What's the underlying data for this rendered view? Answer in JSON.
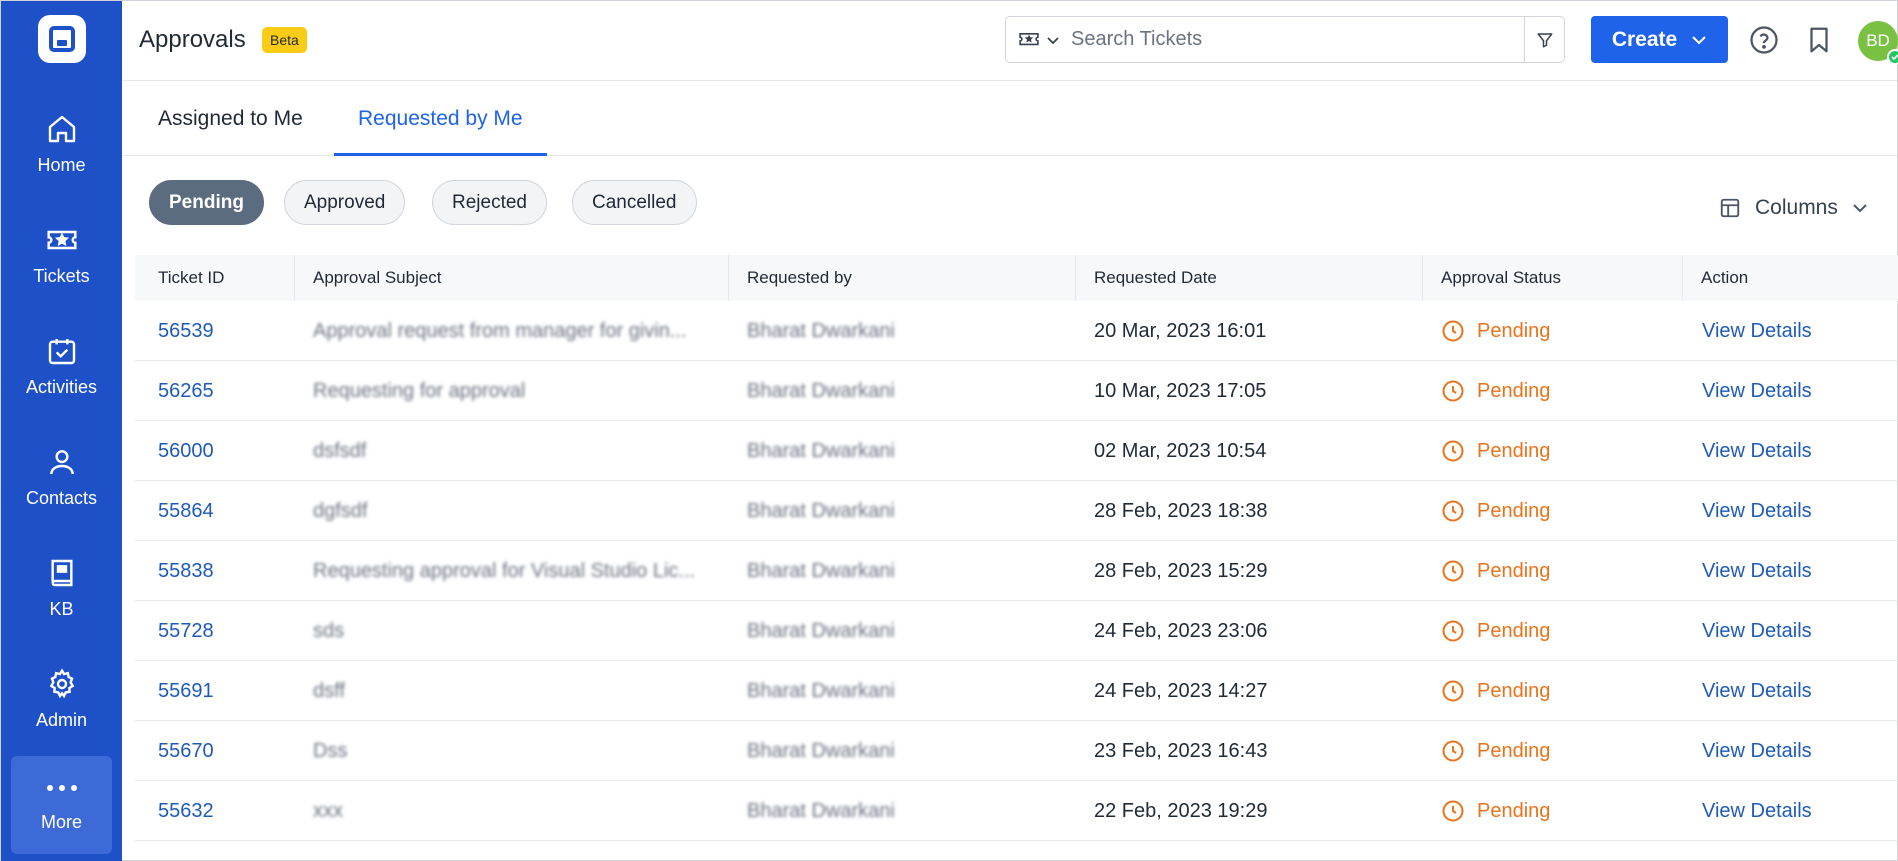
{
  "sidebar": {
    "items": [
      {
        "label": "Home",
        "icon": "home-icon"
      },
      {
        "label": "Tickets",
        "icon": "ticket-icon"
      },
      {
        "label": "Activities",
        "icon": "calendar-check-icon"
      },
      {
        "label": "Contacts",
        "icon": "person-icon"
      },
      {
        "label": "KB",
        "icon": "book-icon"
      },
      {
        "label": "Admin",
        "icon": "gear-icon"
      }
    ],
    "more_label": "More"
  },
  "header": {
    "title": "Approvals",
    "badge": "Beta",
    "search_placeholder": "Search Tickets",
    "create_label": "Create",
    "avatar_initials": "BD"
  },
  "tabs": [
    {
      "label": "Assigned to Me",
      "active": false
    },
    {
      "label": "Requested by Me",
      "active": true
    }
  ],
  "filters": [
    {
      "label": "Pending",
      "active": true
    },
    {
      "label": "Approved",
      "active": false
    },
    {
      "label": "Rejected",
      "active": false
    },
    {
      "label": "Cancelled",
      "active": false
    }
  ],
  "columns_label": "Columns",
  "table": {
    "headers": [
      "Ticket ID",
      "Approval Subject",
      "Requested by",
      "Requested Date",
      "Approval Status",
      "Action"
    ],
    "rows": [
      {
        "id": "56539",
        "subject": "Approval request from manager for givin...",
        "requested_by": "Bharat Dwarkani",
        "date": "20 Mar, 2023 16:01",
        "status": "Pending",
        "action": "View Details"
      },
      {
        "id": "56265",
        "subject": "Requesting for approval",
        "requested_by": "Bharat Dwarkani",
        "date": "10 Mar, 2023 17:05",
        "status": "Pending",
        "action": "View Details"
      },
      {
        "id": "56000",
        "subject": "dsfsdf",
        "requested_by": "Bharat Dwarkani",
        "date": "02 Mar, 2023 10:54",
        "status": "Pending",
        "action": "View Details"
      },
      {
        "id": "55864",
        "subject": "dgfsdf",
        "requested_by": "Bharat Dwarkani",
        "date": "28 Feb, 2023 18:38",
        "status": "Pending",
        "action": "View Details"
      },
      {
        "id": "55838",
        "subject": "Requesting approval for Visual Studio Lic...",
        "requested_by": "Bharat Dwarkani",
        "date": "28 Feb, 2023 15:29",
        "status": "Pending",
        "action": "View Details"
      },
      {
        "id": "55728",
        "subject": "sds",
        "requested_by": "Bharat Dwarkani",
        "date": "24 Feb, 2023 23:06",
        "status": "Pending",
        "action": "View Details"
      },
      {
        "id": "55691",
        "subject": "dsff",
        "requested_by": "Bharat Dwarkani",
        "date": "24 Feb, 2023 14:27",
        "status": "Pending",
        "action": "View Details"
      },
      {
        "id": "55670",
        "subject": "Dss",
        "requested_by": "Bharat Dwarkani",
        "date": "23 Feb, 2023 16:43",
        "status": "Pending",
        "action": "View Details"
      },
      {
        "id": "55632",
        "subject": "xxx",
        "requested_by": "Bharat Dwarkani",
        "date": "22 Feb, 2023 19:29",
        "status": "Pending",
        "action": "View Details"
      }
    ]
  },
  "colors": {
    "sidebar": "#1e50c8",
    "primary": "#1e63e9",
    "link": "#1e5bb8",
    "pending": "#e8731c",
    "beta": "#facc15",
    "avatar": "#7ac143"
  }
}
